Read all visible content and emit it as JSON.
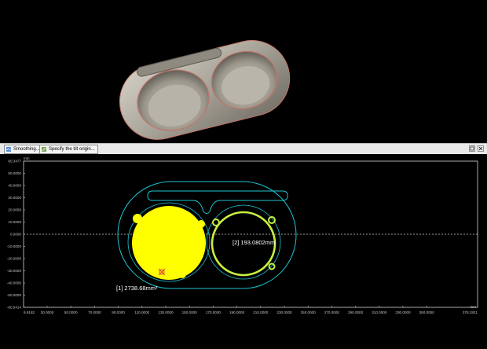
{
  "toolbar": {
    "smoothing_label": "Smoothing...",
    "tilt_origin_label": "Specify the tilt origin..."
  },
  "profile_view": {
    "unit": "mm",
    "y_ticks": [
      "60.3477",
      "50.0000",
      "40.0000",
      "30.0000",
      "20.0000",
      "10.0000",
      "0.0000",
      "-10.0000",
      "-20.0000",
      "-30.0000",
      "-40.0000",
      "-50.0000",
      "-60.5414"
    ],
    "x_ticks": [
      "9.9182",
      "30.0000",
      "50.0000",
      "70.0000",
      "90.0000",
      "110.0000",
      "130.0000",
      "150.0000",
      "170.0000",
      "190.0000",
      "210.0000",
      "230.0000",
      "250.0000",
      "270.0000",
      "290.0000",
      "310.0000",
      "330.0000",
      "350.0000",
      "378.2821"
    ],
    "measurements": [
      {
        "label": "[1] 2738.68mm²",
        "color": "#ffff00"
      },
      {
        "label": "[2] 193.0802mm",
        "color": "#c8f040"
      }
    ],
    "outline_color": "#1ec8d2"
  },
  "icons": [
    "smoothing-icon",
    "tilt-origin-icon",
    "restore-icon",
    "close-icon",
    "origin-marker-icon"
  ]
}
